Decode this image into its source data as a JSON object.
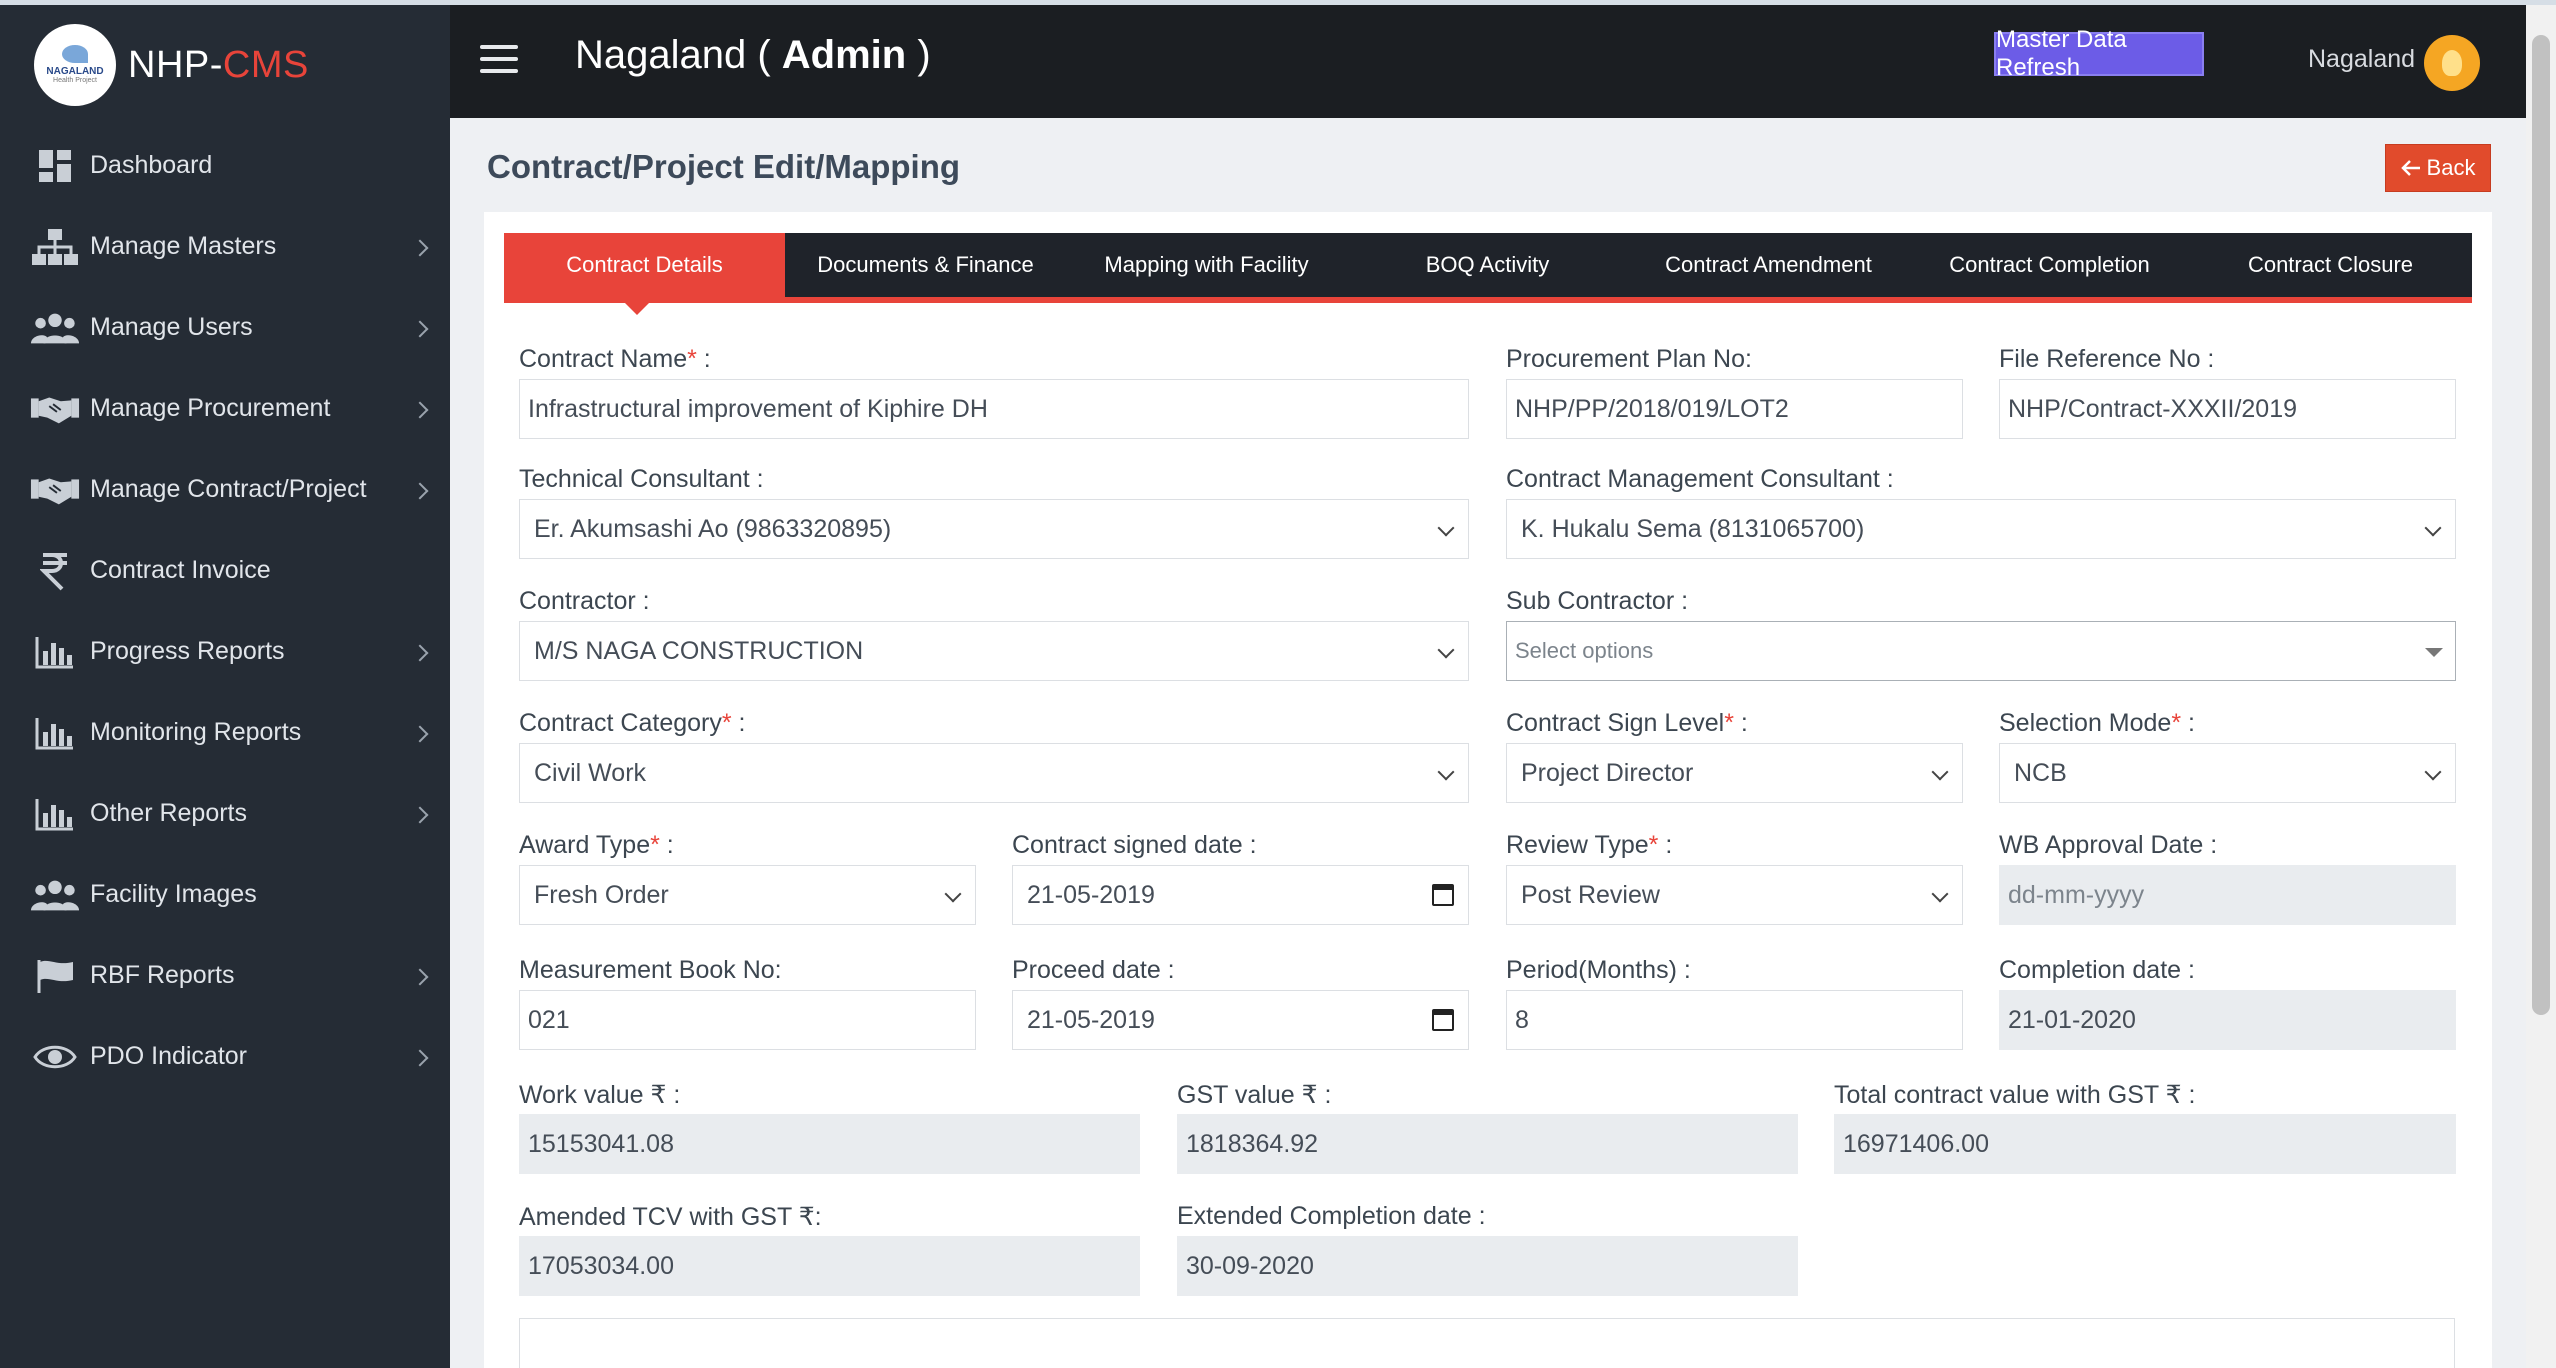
{
  "app": {
    "name_prefix": "NHP-",
    "name_suffix": "CMS",
    "logo_text": "NAGALAND",
    "logo_sub": "Health Project"
  },
  "sidebar": {
    "items": [
      {
        "label": "Dashboard",
        "icon": "dashboard-icon",
        "has_children": false
      },
      {
        "label": "Manage Masters",
        "icon": "hierarchy-icon",
        "has_children": true
      },
      {
        "label": "Manage Users",
        "icon": "users-icon",
        "has_children": true
      },
      {
        "label": "Manage Procurement",
        "icon": "handshake-icon",
        "has_children": true
      },
      {
        "label": "Manage Contract/Project",
        "icon": "handshake-icon",
        "has_children": true
      },
      {
        "label": "Contract Invoice",
        "icon": "rupee-icon",
        "has_children": false
      },
      {
        "label": "Progress Reports",
        "icon": "bar-chart-icon",
        "has_children": true
      },
      {
        "label": "Monitoring Reports",
        "icon": "bar-chart-icon",
        "has_children": true
      },
      {
        "label": "Other Reports",
        "icon": "bar-chart-icon",
        "has_children": true
      },
      {
        "label": "Facility Images",
        "icon": "users-icon",
        "has_children": false
      },
      {
        "label": "RBF Reports",
        "icon": "flag-icon",
        "has_children": true
      },
      {
        "label": "PDO Indicator",
        "icon": "eye-icon",
        "has_children": true
      }
    ]
  },
  "header": {
    "title_prefix": "Nagaland ( ",
    "title_role": "Admin",
    "title_suffix": " )",
    "refresh_label": "Master Data Refresh",
    "user_name": "Nagaland"
  },
  "page": {
    "title": "Contract/Project Edit/Mapping",
    "back_label": "Back"
  },
  "tabs": [
    {
      "label": "Contract Details",
      "active": true
    },
    {
      "label": "Documents & Finance",
      "active": false
    },
    {
      "label": "Mapping with Facility",
      "active": false
    },
    {
      "label": "BOQ Activity",
      "active": false
    },
    {
      "label": "Contract Amendment",
      "active": false
    },
    {
      "label": "Contract Completion",
      "active": false
    },
    {
      "label": "Contract Closure",
      "active": false
    }
  ],
  "form": {
    "contract_name": {
      "label": "Contract Name",
      "value": "Infrastructural improvement of Kiphire DH"
    },
    "procurement_plan_no": {
      "label": "Procurement Plan No:",
      "value": "NHP/PP/2018/019/LOT2"
    },
    "file_reference_no": {
      "label": "File Reference No :",
      "value": "NHP/Contract-XXXII/2019"
    },
    "technical_consultant": {
      "label": "Technical Consultant :",
      "value": "Er. Akumsashi Ao (9863320895)"
    },
    "contract_management_consultant": {
      "label": "Contract Management Consultant :",
      "value": "K. Hukalu Sema (8131065700)"
    },
    "contractor": {
      "label": "Contractor :",
      "value": "M/S NAGA CONSTRUCTION"
    },
    "sub_contractor": {
      "label": "Sub Contractor :",
      "placeholder": "Select options"
    },
    "contract_category": {
      "label": "Contract Category",
      "value": "Civil Work"
    },
    "contract_sign_level": {
      "label": "Contract Sign Level",
      "value": "Project Director"
    },
    "selection_mode": {
      "label": "Selection Mode",
      "value": "NCB"
    },
    "award_type": {
      "label": "Award Type",
      "value": "Fresh Order"
    },
    "contract_signed_date": {
      "label": "Contract signed date :",
      "value": "21-05-2019"
    },
    "review_type": {
      "label": "Review Type",
      "value": "Post Review"
    },
    "wb_approval_date": {
      "label": "WB Approval Date :",
      "placeholder": "dd-mm-yyyy"
    },
    "measurement_book_no": {
      "label": "Measurement Book No:",
      "value": "021"
    },
    "proceed_date": {
      "label": "Proceed date :",
      "value": "21-05-2019"
    },
    "period_months": {
      "label": "Period(Months) :",
      "value": "8"
    },
    "completion_date": {
      "label": "Completion date :",
      "value": "21-01-2020"
    },
    "work_value": {
      "label": "Work value ₹ :",
      "value": "15153041.08"
    },
    "gst_value": {
      "label": "GST value ₹ :",
      "value": "1818364.92"
    },
    "total_contract_value": {
      "label": "Total contract value with GST ₹ :",
      "value": "16971406.00"
    },
    "amended_tcv": {
      "label": "Amended TCV with GST ₹:",
      "value": "17053034.00"
    },
    "extended_completion_date": {
      "label": "Extended Completion date :",
      "value": "30-09-2020"
    },
    "required_mark": "*",
    "required_suffix": " :"
  }
}
